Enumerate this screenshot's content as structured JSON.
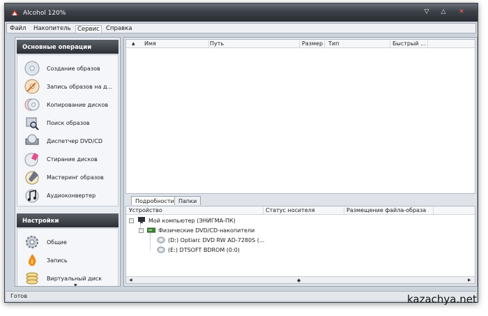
{
  "window": {
    "title": "Alcohol 120%"
  },
  "menu": [
    "Файл",
    "Накопитель",
    "Сервис",
    "Справка"
  ],
  "left_panel": {
    "operations": {
      "header": "Основные операции",
      "items": [
        {
          "label": "Создание образов",
          "icon": "disc-create-icon"
        },
        {
          "label": "Запись образов на д...",
          "icon": "disc-burn-icon"
        },
        {
          "label": "Копирование дисков",
          "icon": "disc-copy-icon"
        },
        {
          "label": "Поиск образов",
          "icon": "image-search-icon"
        },
        {
          "label": "Диспетчер DVD/CD",
          "icon": "dvd-manager-icon"
        },
        {
          "label": "Стирание дисков",
          "icon": "disc-erase-icon"
        },
        {
          "label": "Мастеринг образов",
          "icon": "mastering-icon"
        },
        {
          "label": "Аудиоконвертер",
          "icon": "audio-converter-icon"
        }
      ]
    },
    "settings": {
      "header": "Настройки",
      "items": [
        {
          "label": "Общие",
          "icon": "gear-icon"
        },
        {
          "label": "Запись",
          "icon": "burn-flame-icon"
        },
        {
          "label": "Виртуальный диск",
          "icon": "virtual-disc-icon"
        }
      ]
    }
  },
  "image_table": {
    "columns": [
      "Имя",
      "Путь",
      "Размер",
      "Тип",
      "Быстрый ..."
    ]
  },
  "tabs": [
    "Подробности",
    "Папки"
  ],
  "device_table": {
    "columns": [
      "Устройство",
      "Статус носителя",
      "Размещение файла-образа"
    ],
    "tree": [
      {
        "level": 0,
        "label": "Мой компьютер (ЭНИГМА-ПК)",
        "toggle": "-"
      },
      {
        "level": 1,
        "label": "Физические DVD/CD-накопители",
        "toggle": "-"
      },
      {
        "level": 2,
        "label": "(D:) Optiarc DVD RW AD-7280S (..."
      },
      {
        "level": 2,
        "label": "(E:) DTSOFT BDROM (0:0)"
      }
    ]
  },
  "status": "Готов",
  "watermark": "kazachya.net",
  "colors": {
    "accent_dark": "#2c2f35",
    "panel_bg": "#e9ecf1",
    "close": "#ff6b5c"
  }
}
